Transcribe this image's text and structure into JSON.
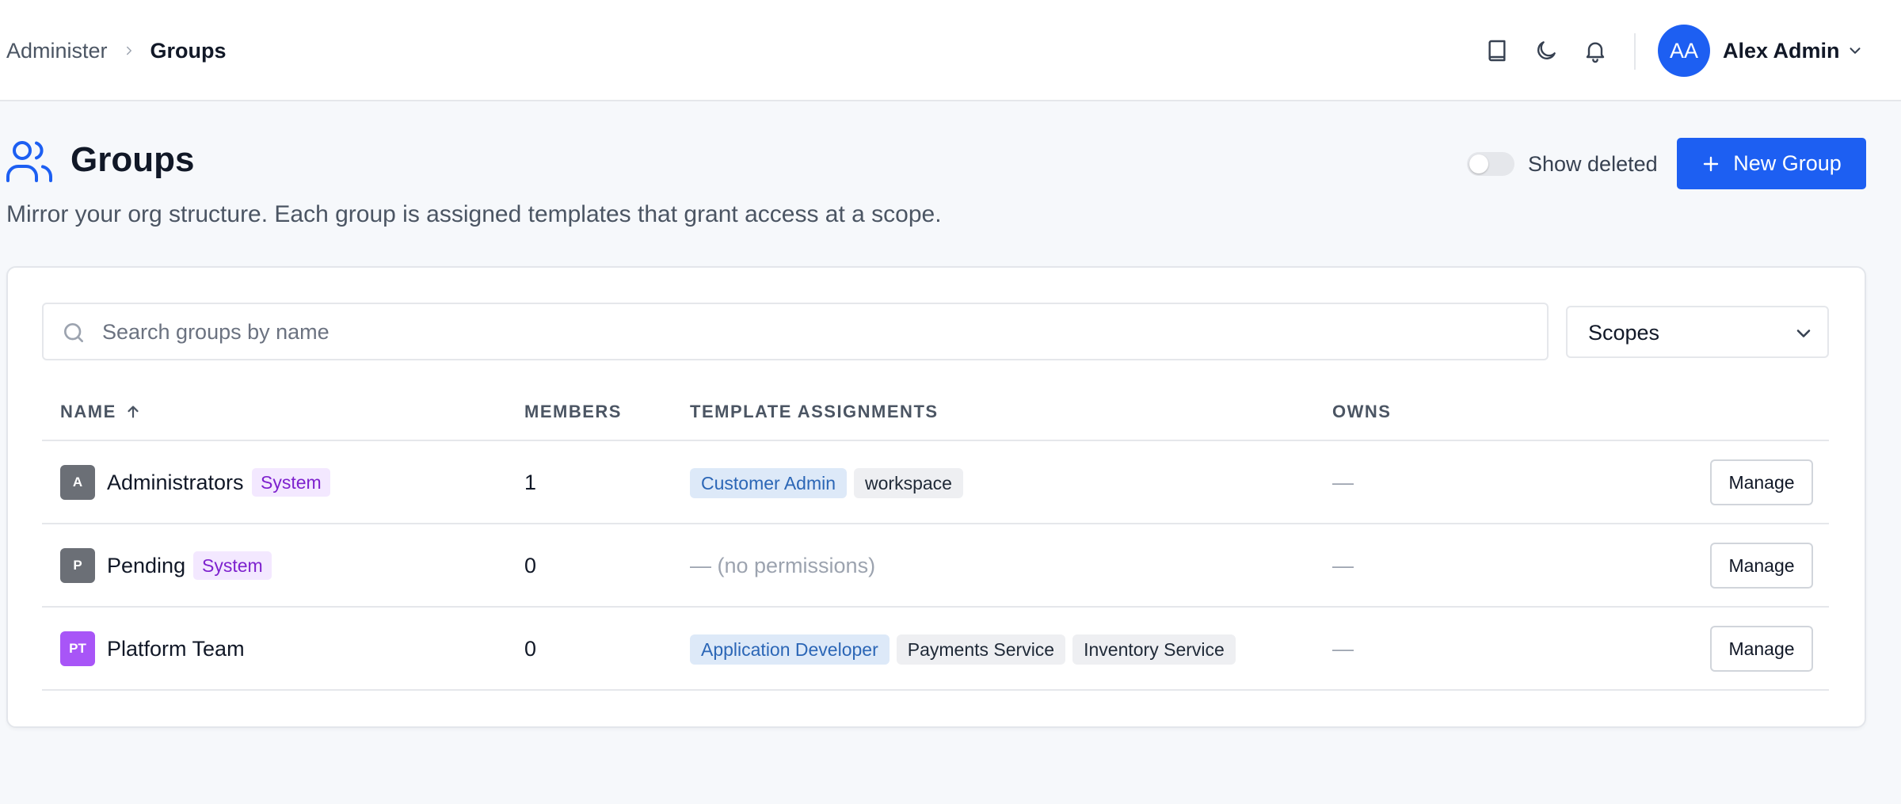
{
  "breadcrumb": {
    "parent": "Administer",
    "current": "Groups"
  },
  "topbar": {
    "icons": [
      "book-icon",
      "moon-icon",
      "bell-icon",
      "chevron-down-icon"
    ],
    "user": {
      "initials": "AA",
      "name": "Alex Admin"
    }
  },
  "page": {
    "title": "Groups",
    "subtitle": "Mirror your org structure. Each group is assigned templates that grant access at a scope.",
    "icon": "users-icon",
    "show_deleted_label": "Show deleted",
    "show_deleted_on": false,
    "new_button_label": "New Group"
  },
  "filters": {
    "search_placeholder": "Search groups by name",
    "search_value": "",
    "scopes_label": "Scopes"
  },
  "table": {
    "headers": {
      "name": "NAME",
      "members": "MEMBERS",
      "templates": "TEMPLATE ASSIGNMENTS",
      "owns": "OWNS"
    },
    "sort": {
      "column": "name",
      "direction": "ascending"
    },
    "rows": [
      {
        "initials": "A",
        "avatar_color": "#6b6f76",
        "name": "Administrators",
        "badge": "System",
        "members": "1",
        "role_tag": "Customer Admin",
        "scope_tags": [
          "workspace"
        ],
        "empty_label": "",
        "owns": "—",
        "action": "Manage"
      },
      {
        "initials": "P",
        "avatar_color": "#6b6f76",
        "name": "Pending",
        "badge": "System",
        "members": "0",
        "role_tag": "",
        "scope_tags": [],
        "empty_label": "— (no permissions)",
        "owns": "—",
        "action": "Manage"
      },
      {
        "initials": "PT",
        "avatar_color": "#a855f7",
        "name": "Platform Team",
        "badge": "",
        "members": "0",
        "role_tag": "Application Developer",
        "scope_tags": [
          "Payments Service",
          "Inventory Service"
        ],
        "empty_label": "",
        "owns": "—",
        "action": "Manage"
      }
    ]
  },
  "colors": {
    "accent": "#1d5ff2",
    "system_badge_bg": "#f3e8ff",
    "system_badge_text": "#7e22ce",
    "role_tag_bg": "#dde9f8",
    "role_tag_text": "#2b66b6"
  }
}
